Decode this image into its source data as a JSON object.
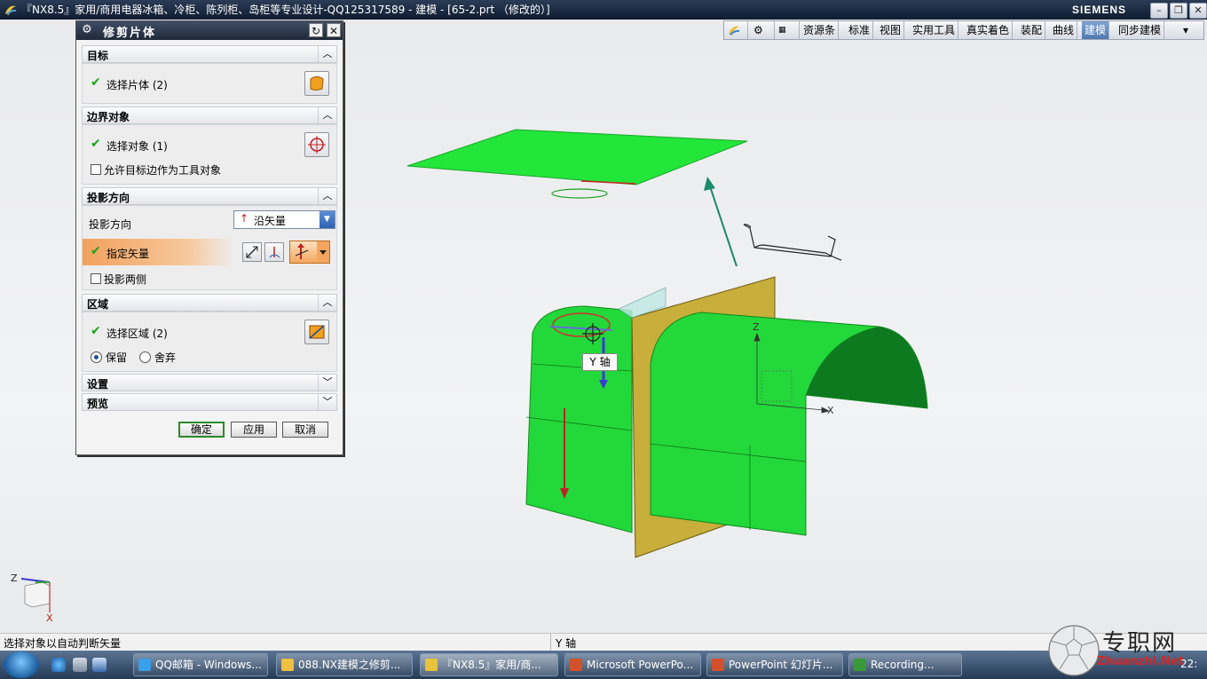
{
  "window": {
    "title": "『NX8.5』家用/商用电器冰箱、冷柜、陈列柜、岛柜等专业设计-QQ125317589 - 建模 - [65-2.prt （修改的）]",
    "brand": "SIEMENS"
  },
  "ribbon": {
    "tabs": [
      "资源条",
      "标准",
      "视图",
      "实用工具",
      "真实着色",
      "装配",
      "曲线",
      "建模",
      "同步建模"
    ],
    "active": "建模"
  },
  "dialog": {
    "title": "修剪片体",
    "sections": {
      "target": {
        "label": "目标",
        "select_label": "选择片体 (2)"
      },
      "boundary": {
        "label": "边界对象",
        "select_label": "选择对象 (1)",
        "allow_label": "允许目标边作为工具对象"
      },
      "projection": {
        "label": "投影方向",
        "direction_label": "投影方向",
        "direction_value": "沿矢量",
        "vector_label": "指定矢量",
        "both_sides_label": "投影两侧"
      },
      "region": {
        "label": "区域",
        "select_label": "选择区域 (2)",
        "keep_label": "保留",
        "discard_label": "舍弃",
        "keep_selected": true
      },
      "settings": {
        "label": "设置"
      },
      "preview": {
        "label": "预览"
      }
    },
    "buttons": {
      "ok": "确定",
      "apply": "应用",
      "cancel": "取消"
    }
  },
  "viewport": {
    "cursor_tooltip": "Y 轴",
    "wcs_labels": {
      "z": "Z",
      "x": "X"
    },
    "triad_labels": {
      "z": "Z",
      "x": "X"
    },
    "colors": {
      "sheet": "#22e63a",
      "tool": "#c8ae3a",
      "background": "#eceef0"
    }
  },
  "status": {
    "prompt": "选择对象以自动判断矢量",
    "info": "Y 轴"
  },
  "taskbar": {
    "items": [
      "QQ邮箱 - Windows...",
      "088.NX建模之修剪...",
      "『NX8.5』家用/商...",
      "Microsoft PowerPo...",
      "PowerPoint 幻灯片...",
      "Recording..."
    ],
    "clock": "22:"
  },
  "watermark": {
    "text": "专职网",
    "url": "Zhuanzhi.Net"
  }
}
